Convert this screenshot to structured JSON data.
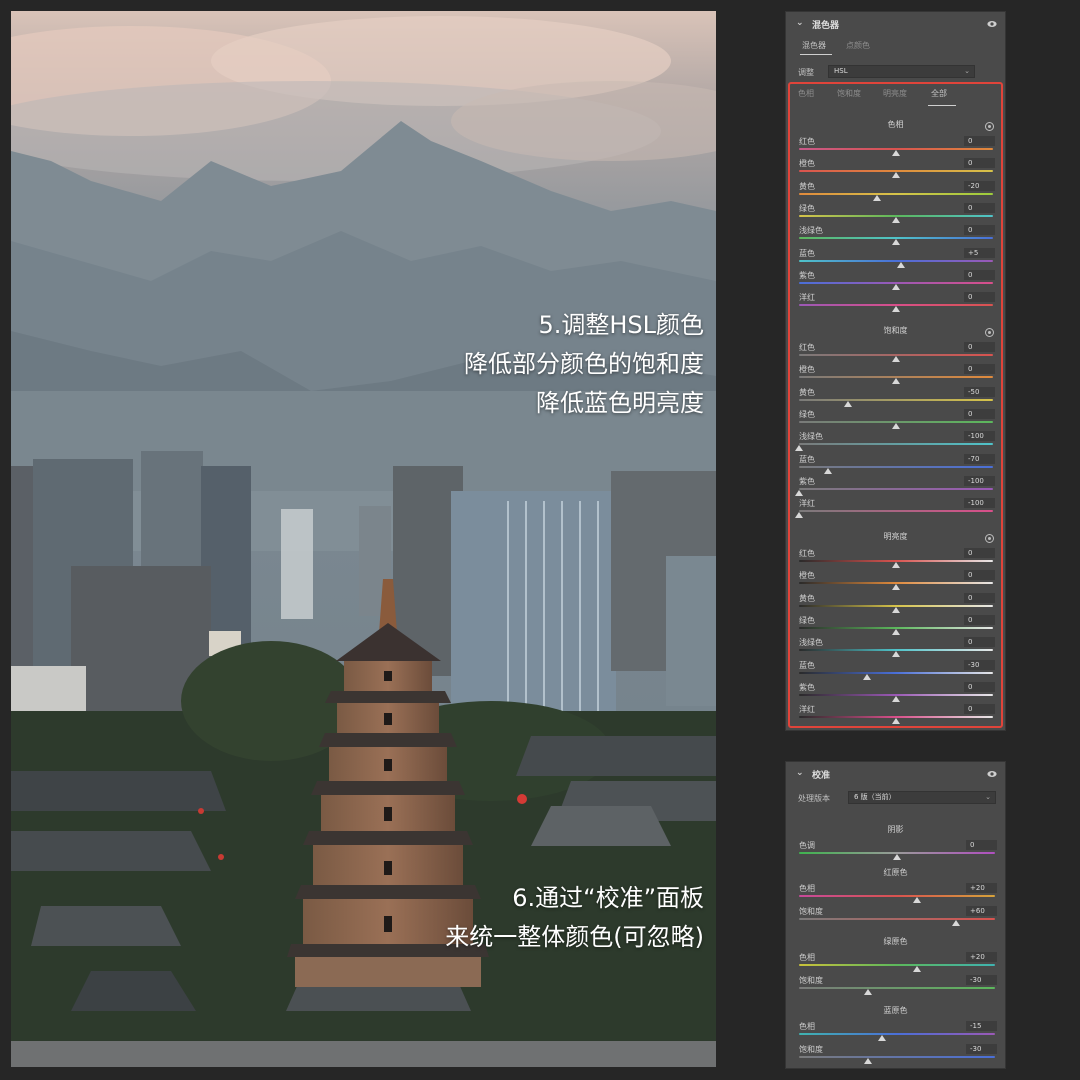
{
  "overlay_top": [
    "5.调整HSL颜色",
    "降低部分颜色的饱和度",
    "降低蓝色明亮度"
  ],
  "overlay_bottom": [
    "6.通过“校准”面板",
    "来统一整体颜色(可忽略)"
  ],
  "mixer": {
    "title": "混色器",
    "tabs": [
      "混色器",
      "点颜色"
    ],
    "adjust_label": "调整",
    "adjust_value": "HSL",
    "subtabs": [
      "色相",
      "饱和度",
      "明亮度",
      "全部"
    ],
    "active_subtab": "全部",
    "sections": [
      {
        "title": "色相",
        "rows": [
          {
            "label": "红色",
            "value": "0",
            "n": 0
          },
          {
            "label": "橙色",
            "value": "0",
            "n": 0
          },
          {
            "label": "黄色",
            "value": "-20",
            "n": -20
          },
          {
            "label": "绿色",
            "value": "0",
            "n": 0
          },
          {
            "label": "浅绿色",
            "value": "0",
            "n": 0
          },
          {
            "label": "蓝色",
            "value": "+5",
            "n": 5
          },
          {
            "label": "紫色",
            "value": "0",
            "n": 0
          },
          {
            "label": "洋红",
            "value": "0",
            "n": 0
          }
        ]
      },
      {
        "title": "饱和度",
        "rows": [
          {
            "label": "红色",
            "value": "0",
            "n": 0
          },
          {
            "label": "橙色",
            "value": "0",
            "n": 0
          },
          {
            "label": "黄色",
            "value": "-50",
            "n": -50
          },
          {
            "label": "绿色",
            "value": "0",
            "n": 0
          },
          {
            "label": "浅绿色",
            "value": "-100",
            "n": -100
          },
          {
            "label": "蓝色",
            "value": "-70",
            "n": -70
          },
          {
            "label": "紫色",
            "value": "-100",
            "n": -100
          },
          {
            "label": "洋红",
            "value": "-100",
            "n": -100
          }
        ]
      },
      {
        "title": "明亮度",
        "rows": [
          {
            "label": "红色",
            "value": "0",
            "n": 0
          },
          {
            "label": "橙色",
            "value": "0",
            "n": 0
          },
          {
            "label": "黄色",
            "value": "0",
            "n": 0
          },
          {
            "label": "绿色",
            "value": "0",
            "n": 0
          },
          {
            "label": "浅绿色",
            "value": "0",
            "n": 0
          },
          {
            "label": "蓝色",
            "value": "-30",
            "n": -30
          },
          {
            "label": "紫色",
            "value": "0",
            "n": 0
          },
          {
            "label": "洋红",
            "value": "0",
            "n": 0
          }
        ]
      }
    ]
  },
  "calibration": {
    "title": "校准",
    "version_label": "处理版本",
    "version_value": "6 版（当前）",
    "sections": [
      {
        "title": "阴影",
        "rows": [
          {
            "label": "色调",
            "value": "0",
            "n": 0
          }
        ]
      },
      {
        "title": "红原色",
        "rows": [
          {
            "label": "色相",
            "value": "+20",
            "n": 20
          },
          {
            "label": "饱和度",
            "value": "+60",
            "n": 60
          }
        ]
      },
      {
        "title": "绿原色",
        "rows": [
          {
            "label": "色相",
            "value": "+20",
            "n": 20
          },
          {
            "label": "饱和度",
            "value": "-30",
            "n": -30
          }
        ]
      },
      {
        "title": "蓝原色",
        "rows": [
          {
            "label": "色相",
            "value": "-15",
            "n": -15
          },
          {
            "label": "饱和度",
            "value": "-30",
            "n": -30
          }
        ]
      }
    ]
  },
  "gradients": {
    "hue": [
      "#d9534f #e08a3c #d6c34a #5cb85c #4fc3c9 #4a6fd8 #9b59b6 #d9534f",
      "#e08a3c #d6c34a #9ccc3c #4fc3c9 #4a6fd8 #9b59b6 #d94f8a #d9534f"
    ],
    "sat": [
      "#7a7a7a",
      "#e0443a"
    ],
    "lum": [
      "#2a2a2a",
      "#e6e6e6"
    ]
  }
}
